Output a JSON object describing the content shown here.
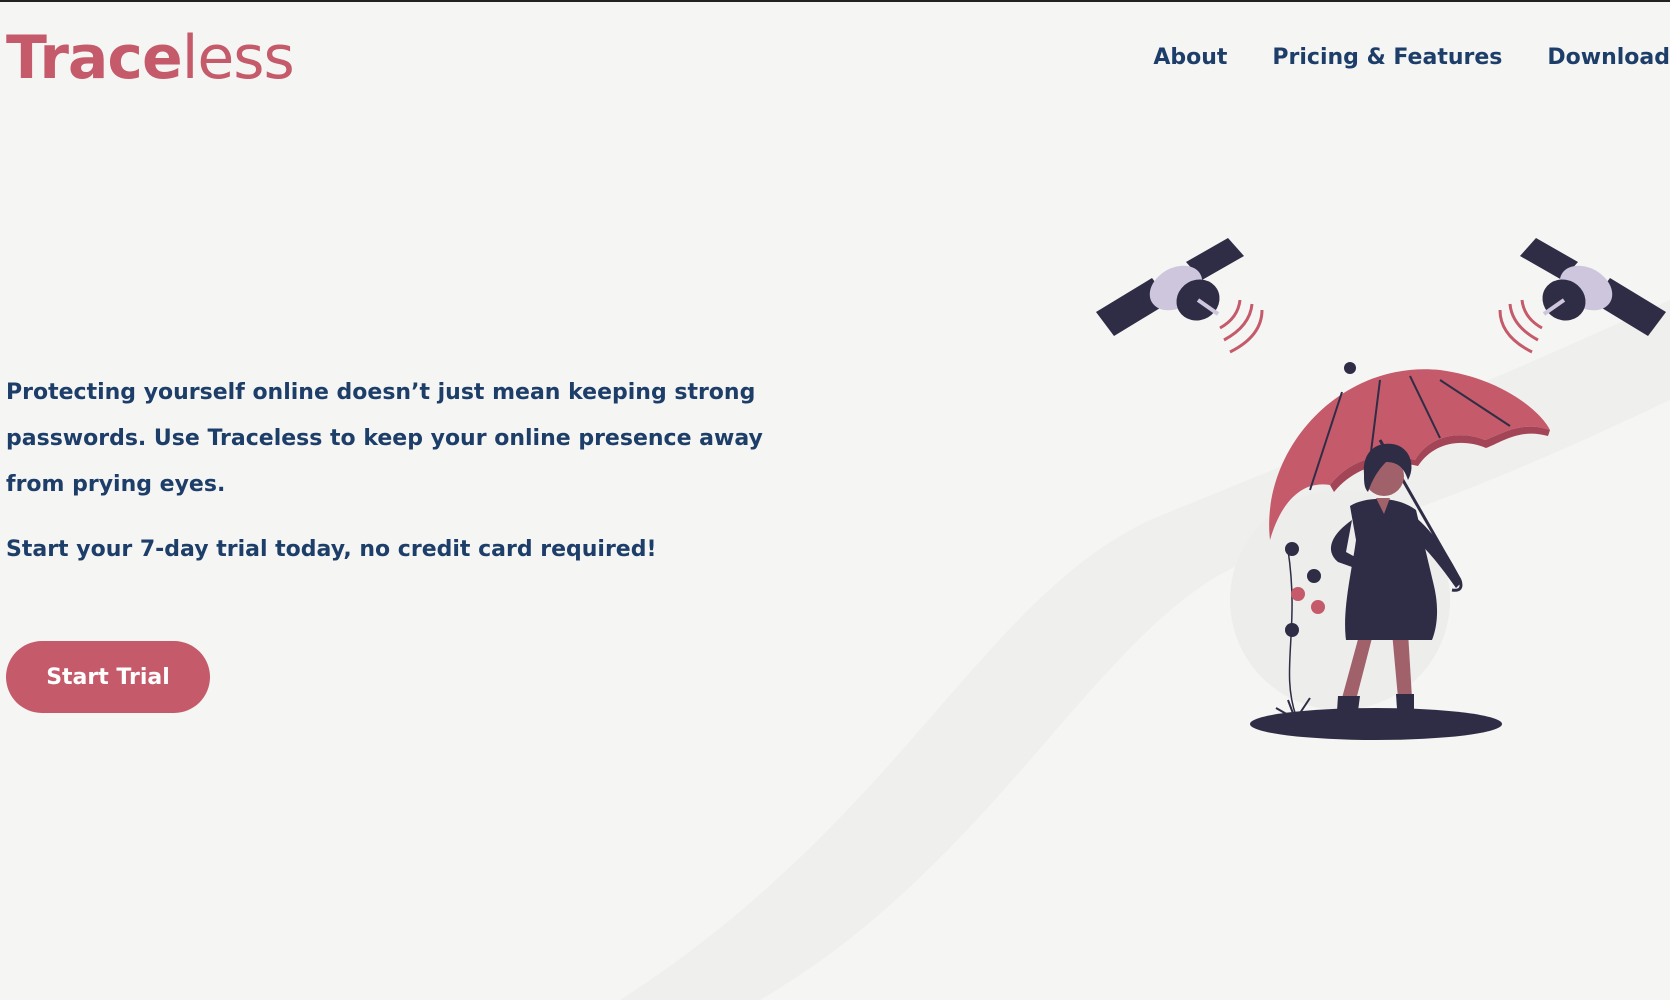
{
  "header": {
    "logo_bold": "Trace",
    "logo_light": "less",
    "nav": [
      {
        "label": "About"
      },
      {
        "label": "Pricing & Features"
      },
      {
        "label": "Download"
      }
    ]
  },
  "hero": {
    "description": "Protecting yourself online doesn’t just mean keeping strong passwords. Use Traceless to keep your online presence away from prying eyes.",
    "subtext": "Start your 7-day trial today, no credit card required!",
    "cta_label": "Start Trial"
  },
  "colors": {
    "brand": "#c45a6a",
    "text": "#1e3e6a",
    "background": "#f5f5f3",
    "illustration_dark": "#2f2c46"
  },
  "illustration": {
    "icons": [
      "satellite-icon",
      "satellite-icon",
      "umbrella-icon",
      "woman-figure-icon",
      "plant-icon"
    ]
  }
}
